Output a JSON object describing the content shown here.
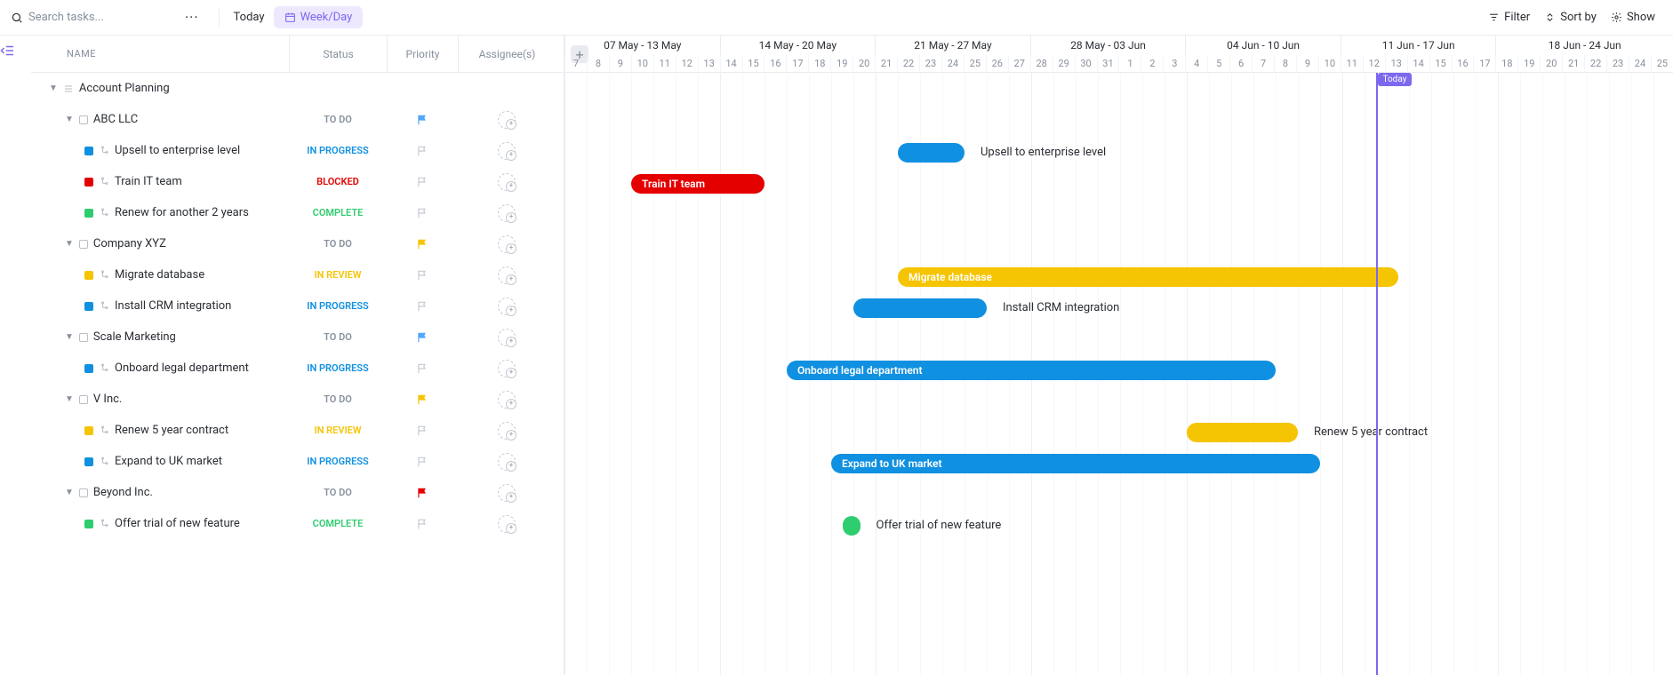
{
  "toolbar": {
    "search_placeholder": "Search tasks...",
    "today": "Today",
    "weekday": "Week/Day",
    "filter": "Filter",
    "sortby": "Sort by",
    "show": "Show"
  },
  "columns": {
    "name": "NAME",
    "status": "Status",
    "priority": "Priority",
    "assignee": "Assignee(s)"
  },
  "tree": {
    "root": "Account Planning",
    "groups": [
      {
        "name": "ABC LLC",
        "status": "TO DO",
        "flag": "#4fa7ff",
        "items": [
          {
            "name": "Upsell to enterprise level",
            "status": "IN PROGRESS",
            "color": "#1090e0"
          },
          {
            "name": "Train IT team",
            "status": "BLOCKED",
            "color": "#e50000"
          },
          {
            "name": "Renew for another 2 years",
            "status": "COMPLETE",
            "color": "#2ecd6f"
          }
        ]
      },
      {
        "name": "Company XYZ",
        "status": "TO DO",
        "flag": "#f5c402",
        "items": [
          {
            "name": "Migrate database",
            "status": "IN REVIEW",
            "color": "#f5c402"
          },
          {
            "name": "Install CRM integration",
            "status": "IN PROGRESS",
            "color": "#1090e0"
          }
        ]
      },
      {
        "name": "Scale Marketing",
        "status": "TO DO",
        "flag": "#4fa7ff",
        "items": [
          {
            "name": "Onboard legal department",
            "status": "IN PROGRESS",
            "color": "#1090e0"
          }
        ]
      },
      {
        "name": "V Inc.",
        "status": "TO DO",
        "flag": "#f5c402",
        "items": [
          {
            "name": "Renew 5 year contract",
            "status": "IN REVIEW",
            "color": "#f5c402"
          },
          {
            "name": "Expand to UK market",
            "status": "IN PROGRESS",
            "color": "#1090e0"
          }
        ]
      },
      {
        "name": "Beyond Inc.",
        "status": "TO DO",
        "flag": "#e50000",
        "items": [
          {
            "name": "Offer trial of new feature",
            "status": "COMPLETE",
            "color": "#2ecd6f"
          }
        ]
      }
    ]
  },
  "timeline": {
    "day_width": 25,
    "start_day_index": 0,
    "today_label": "Today",
    "today_day_offset": 36.5,
    "weeks": [
      {
        "label": "07 May - 13 May",
        "days": [
          "7",
          "8",
          "9",
          "10",
          "11",
          "12",
          "13"
        ]
      },
      {
        "label": "14 May - 20 May",
        "days": [
          "14",
          "15",
          "16",
          "17",
          "18",
          "19",
          "20"
        ]
      },
      {
        "label": "21 May - 27 May",
        "days": [
          "21",
          "22",
          "23",
          "24",
          "25",
          "26",
          "27"
        ]
      },
      {
        "label": "28 May - 03 Jun",
        "days": [
          "28",
          "29",
          "30",
          "31",
          "1",
          "2",
          "3"
        ]
      },
      {
        "label": "04 Jun - 10 Jun",
        "days": [
          "4",
          "5",
          "6",
          "7",
          "8",
          "9",
          "10"
        ]
      },
      {
        "label": "11 Jun - 17 Jun",
        "days": [
          "11",
          "12",
          "13",
          "14",
          "15",
          "16",
          "17"
        ]
      },
      {
        "label": "18 Jun - 24 Jun",
        "days": [
          "18",
          "19",
          "20",
          "21",
          "22",
          "23",
          "24",
          "25"
        ]
      }
    ],
    "bars": [
      {
        "row": 2,
        "start": 15,
        "span": 3,
        "color": "#1090e0",
        "label": "Upsell to enterprise level",
        "label_pos": "out"
      },
      {
        "row": 3,
        "start": 3,
        "span": 6,
        "color": "#e50000",
        "label": "Train IT team",
        "label_pos": "in"
      },
      {
        "row": 6,
        "start": 15,
        "span": 22.5,
        "color": "#f5c402",
        "label": "Migrate database",
        "label_pos": "in"
      },
      {
        "row": 7,
        "start": 13,
        "span": 6,
        "color": "#1090e0",
        "label": "Install CRM integration",
        "label_pos": "out"
      },
      {
        "row": 9,
        "start": 10,
        "span": 22,
        "color": "#1090e0",
        "label": "Onboard legal department",
        "label_pos": "in"
      },
      {
        "row": 11,
        "start": 28,
        "span": 5,
        "color": "#f5c402",
        "label": "Renew 5 year contract",
        "label_pos": "out"
      },
      {
        "row": 12,
        "start": 12,
        "span": 22,
        "color": "#1090e0",
        "label": "Expand to UK market",
        "label_pos": "in"
      },
      {
        "row": 14,
        "start": 12.5,
        "span": 0.8,
        "color": "#2ecd6f",
        "label": "Offer trial of new feature",
        "label_pos": "out"
      }
    ]
  },
  "chart_data": {
    "type": "gantt",
    "unit": "day",
    "axis_start": "2018-05-07",
    "axis_end": "2018-06-25",
    "today": "2018-06-12",
    "tasks": [
      {
        "group": "ABC LLC",
        "name": "Upsell to enterprise level",
        "start": "2018-05-22",
        "end": "2018-05-24",
        "status": "IN PROGRESS",
        "color": "blue"
      },
      {
        "group": "ABC LLC",
        "name": "Train IT team",
        "start": "2018-05-10",
        "end": "2018-05-15",
        "status": "BLOCKED",
        "color": "red"
      },
      {
        "group": "ABC LLC",
        "name": "Renew for another 2 years",
        "start": null,
        "end": null,
        "status": "COMPLETE",
        "color": "green"
      },
      {
        "group": "Company XYZ",
        "name": "Migrate database",
        "start": "2018-05-22",
        "end": "2018-06-13",
        "status": "IN REVIEW",
        "color": "yellow"
      },
      {
        "group": "Company XYZ",
        "name": "Install CRM integration",
        "start": "2018-05-20",
        "end": "2018-05-25",
        "status": "IN PROGRESS",
        "color": "blue"
      },
      {
        "group": "Scale Marketing",
        "name": "Onboard legal department",
        "start": "2018-05-17",
        "end": "2018-06-07",
        "status": "IN PROGRESS",
        "color": "blue"
      },
      {
        "group": "V Inc.",
        "name": "Renew 5 year contract",
        "start": "2018-06-04",
        "end": "2018-06-08",
        "status": "IN REVIEW",
        "color": "yellow"
      },
      {
        "group": "V Inc.",
        "name": "Expand to UK market",
        "start": "2018-05-19",
        "end": "2018-06-09",
        "status": "IN PROGRESS",
        "color": "blue"
      },
      {
        "group": "Beyond Inc.",
        "name": "Offer trial of new feature",
        "start": "2018-05-19",
        "end": "2018-05-19",
        "status": "COMPLETE",
        "color": "green"
      }
    ]
  }
}
